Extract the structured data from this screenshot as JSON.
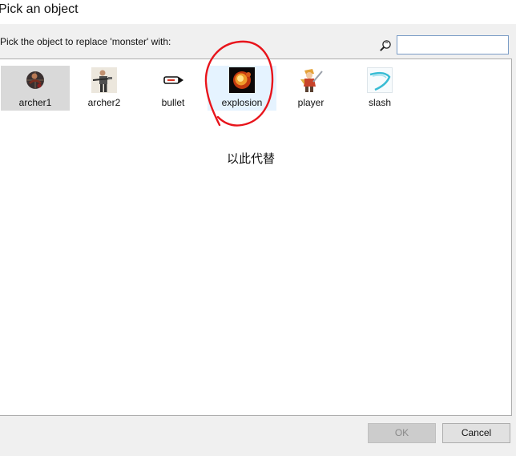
{
  "window": {
    "title": "Pick an object"
  },
  "prompt": "Pick the object to replace 'monster' with:",
  "search": {
    "value": "",
    "placeholder": "",
    "icon": "search-icon"
  },
  "objects": [
    {
      "label": "archer1",
      "icon": "archer1-sprite",
      "state": "selected"
    },
    {
      "label": "archer2",
      "icon": "archer2-sprite",
      "state": "normal"
    },
    {
      "label": "bullet",
      "icon": "bullet-sprite",
      "state": "normal"
    },
    {
      "label": "explosion",
      "icon": "explosion-sprite",
      "state": "hover"
    },
    {
      "label": "player",
      "icon": "player-sprite",
      "state": "normal"
    },
    {
      "label": "slash",
      "icon": "slash-sprite",
      "state": "normal"
    }
  ],
  "annotation": {
    "text": "以此代替",
    "color": "#e8141b"
  },
  "buttons": {
    "ok": "OK",
    "cancel": "Cancel",
    "ok_enabled": false
  },
  "colors": {
    "selected_bg": "#d9d9d9",
    "hover_bg": "#e5f3ff",
    "input_border": "#7a9cc6"
  }
}
